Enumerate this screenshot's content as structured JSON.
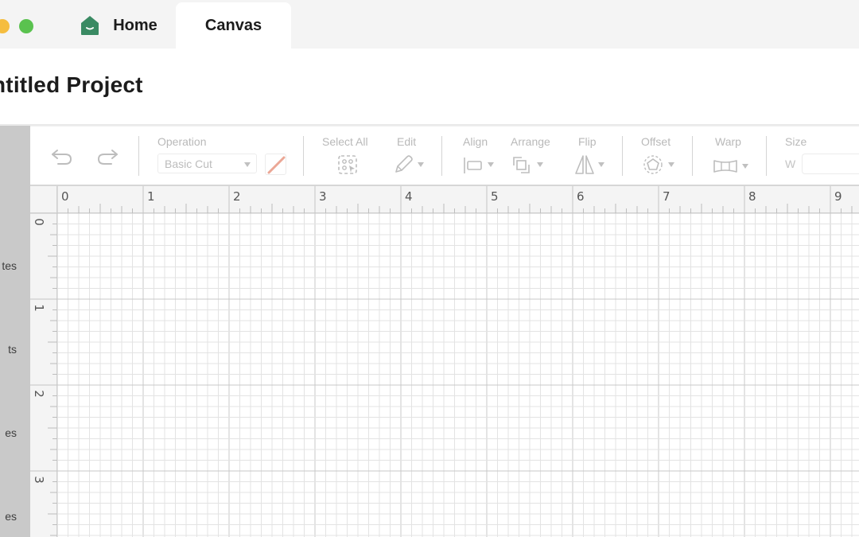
{
  "window": {
    "traffic_lights": [
      "minimize",
      "zoom"
    ],
    "colors": {
      "yellow": "#f5bd3f",
      "green": "#5ac24f"
    }
  },
  "tabs": [
    {
      "label": "Home",
      "icon": "home-icon",
      "active": false
    },
    {
      "label": "Canvas",
      "active": true
    }
  ],
  "brand": {
    "accent": "#3a8a63"
  },
  "project": {
    "title": "ntitled Project"
  },
  "sidebar": {
    "items": [
      {
        "label": "tes"
      },
      {
        "label": "ts"
      },
      {
        "label": "es"
      },
      {
        "label": "es"
      }
    ]
  },
  "toolbar": {
    "undo_icon": "undo-icon",
    "redo_icon": "redo-icon",
    "operation": {
      "label": "Operation",
      "value": "Basic Cut",
      "color_swatch": "#eba796"
    },
    "select_all": {
      "label": "Select All",
      "icon": "select-all-icon"
    },
    "edit": {
      "label": "Edit",
      "icon": "pencil-icon"
    },
    "align": {
      "label": "Align",
      "icon": "align-left-icon"
    },
    "arrange": {
      "label": "Arrange",
      "icon": "arrange-icon"
    },
    "flip": {
      "label": "Flip",
      "icon": "flip-icon"
    },
    "offset": {
      "label": "Offset",
      "icon": "offset-icon"
    },
    "warp": {
      "label": "Warp",
      "icon": "warp-icon"
    },
    "size": {
      "label": "Size",
      "w_label": "W",
      "w_value": ""
    }
  },
  "ruler": {
    "unit": "in",
    "horizontal_labels": [
      "0",
      "1",
      "2",
      "3",
      "4",
      "5",
      "6",
      "7",
      "8",
      "9"
    ],
    "vertical_labels": [
      "0",
      "1",
      "2",
      "3"
    ],
    "subdivisions_per_unit": 8
  }
}
